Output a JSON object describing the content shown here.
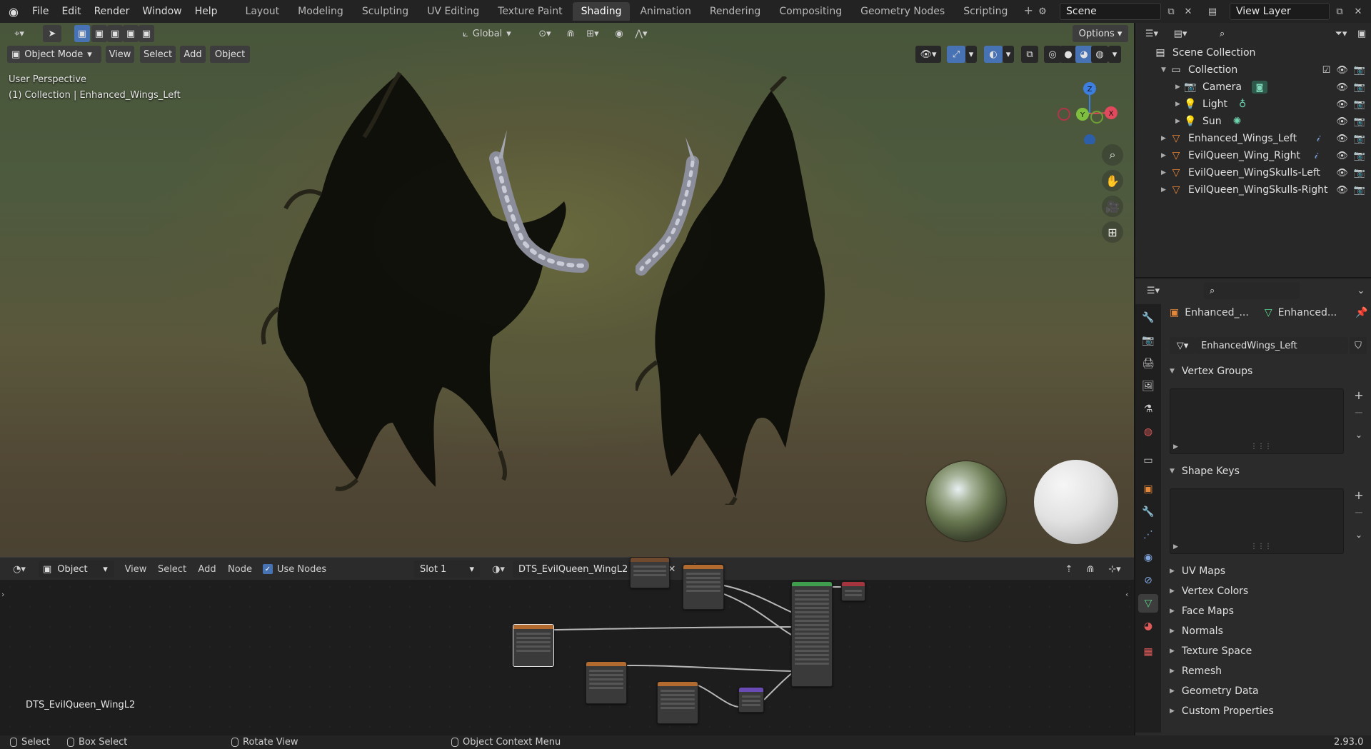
{
  "topbar": {
    "menus": [
      "File",
      "Edit",
      "Render",
      "Window",
      "Help"
    ],
    "workspaces": [
      "Layout",
      "Modeling",
      "Sculpting",
      "UV Editing",
      "Texture Paint",
      "Shading",
      "Animation",
      "Rendering",
      "Compositing",
      "Geometry Nodes",
      "Scripting"
    ],
    "active_workspace": "Shading",
    "add_tab": "+",
    "scene": "Scene",
    "view_layer": "View Layer"
  },
  "viewport": {
    "transform_orientation": "Global",
    "options_label": "Options",
    "mode": "Object Mode",
    "menus": [
      "View",
      "Select",
      "Add",
      "Object"
    ],
    "perspective_label": "User Perspective",
    "collection_label": "(1) Collection | Enhanced_Wings_Left",
    "gizmo_axes": {
      "z": "Z",
      "y": "Y",
      "x": "X"
    }
  },
  "node_editor": {
    "type": "Object",
    "menus": [
      "View",
      "Select",
      "Add",
      "Node"
    ],
    "use_nodes_label": "Use Nodes",
    "use_nodes_checked": true,
    "slot": "Slot 1",
    "material": "DTS_EvilQueen_WingL2",
    "label": "DTS_EvilQueen_WingL2"
  },
  "statusbar": {
    "select": "Select",
    "box_select": "Box Select",
    "rotate_view": "Rotate View",
    "context_menu": "Object Context Menu",
    "version": "2.93.0"
  },
  "outliner": {
    "scene_collection": "Scene Collection",
    "items": [
      {
        "label": "Collection",
        "depth": 1,
        "icon": "collection-icon"
      },
      {
        "label": "Camera",
        "depth": 2,
        "icon": "camera-icon"
      },
      {
        "label": "Light",
        "depth": 2,
        "icon": "light-icon"
      },
      {
        "label": "Sun",
        "depth": 2,
        "icon": "sun-icon"
      },
      {
        "label": "Enhanced_Wings_Left",
        "depth": 1,
        "icon": "mesh-icon"
      },
      {
        "label": "EvilQueen_Wing_Right",
        "depth": 1,
        "icon": "mesh-icon"
      },
      {
        "label": "EvilQueen_WingSkulls-Left",
        "depth": 1,
        "icon": "mesh-icon"
      },
      {
        "label": "EvilQueen_WingSkulls-Right",
        "depth": 1,
        "icon": "mesh-icon"
      }
    ]
  },
  "properties": {
    "breadcrumb_object": "Enhanced_...",
    "breadcrumb_data": "Enhanced...",
    "mesh_name": "EnhancedWings_Left",
    "vertex_groups": "Vertex Groups",
    "shape_keys": "Shape Keys",
    "collapsed_sections": [
      "UV Maps",
      "Vertex Colors",
      "Face Maps",
      "Normals",
      "Texture Space",
      "Remesh",
      "Geometry Data",
      "Custom Properties"
    ]
  },
  "colors": {
    "accent_blue": "#4772b3",
    "axis_x": "#e04a5c",
    "axis_y": "#7fbf3f",
    "axis_z": "#3c7fe0",
    "active_object_orange": "#e6883a"
  }
}
